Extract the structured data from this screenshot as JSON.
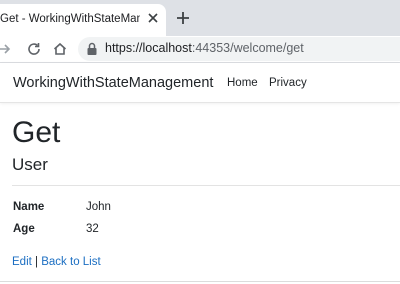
{
  "browser": {
    "tab_title": "Get - WorkingWithStateManagem",
    "url_prefix": "https://localhost",
    "url_suffix": ":44353/welcome/get"
  },
  "navbar": {
    "brand": "WorkingWithStateManagement",
    "links": [
      "Home",
      "Privacy"
    ]
  },
  "page": {
    "heading": "Get",
    "subheading": "User",
    "details": [
      {
        "label": "Name",
        "value": "John"
      },
      {
        "label": "Age",
        "value": "32"
      }
    ],
    "edit_link": "Edit",
    "separator": "|",
    "back_link": "Back to List"
  },
  "colors": {
    "link": "#1b6ec2",
    "text": "#212529",
    "chrome_bg": "#dee1e6"
  }
}
